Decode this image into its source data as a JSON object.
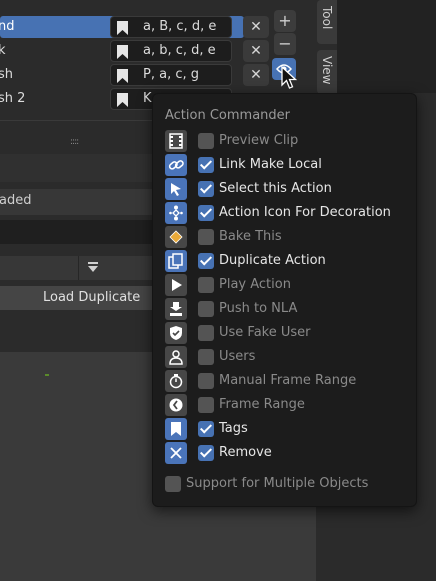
{
  "list": {
    "rows": [
      {
        "name": "nd",
        "tags": "a, B, c, d, e"
      },
      {
        "name": "k",
        "tags": "a, b, c, d, e"
      },
      {
        "name": "sh",
        "tags": "P, a, c, g"
      },
      {
        "name": "sh 2",
        "tags": "K"
      }
    ],
    "remove_glyph": "✕",
    "add_glyph": "+",
    "minus_glyph": "−"
  },
  "tabs": {
    "tool": "Tool",
    "view": "View"
  },
  "panel": {
    "drag_handle": "::::",
    "loaded_label": "aded",
    "load_duplicate": "Load Duplicate"
  },
  "popup": {
    "title": "Action Commander",
    "items": [
      {
        "icon": "film-clip-icon",
        "label": "Preview Clip",
        "checked": false
      },
      {
        "icon": "link-icon",
        "label": "Link Make Local",
        "checked": true
      },
      {
        "icon": "cursor-icon",
        "label": "Select this Action",
        "checked": true
      },
      {
        "icon": "decoration-icon",
        "label": "Action Icon For Decoration",
        "checked": true
      },
      {
        "icon": "keyframe-icon",
        "label": "Bake This",
        "checked": false
      },
      {
        "icon": "duplicate-icon",
        "label": "Duplicate Action",
        "checked": true
      },
      {
        "icon": "play-icon",
        "label": "Play Action",
        "checked": false
      },
      {
        "icon": "push-nla-icon",
        "label": "Push to NLA",
        "checked": false
      },
      {
        "icon": "shield-icon",
        "label": "Use Fake User",
        "checked": false
      },
      {
        "icon": "user-icon",
        "label": "Users",
        "checked": false
      },
      {
        "icon": "stopwatch-icon",
        "label": "Manual Frame Range",
        "checked": false
      },
      {
        "icon": "clock-icon",
        "label": "Frame Range",
        "checked": false
      },
      {
        "icon": "bookmark-icon",
        "label": "Tags",
        "checked": true
      },
      {
        "icon": "close-icon",
        "label": "Remove",
        "checked": true
      }
    ],
    "footer_label": "Support for Multiple Objects",
    "footer_checked": false
  },
  "colors": {
    "accent": "#4772b3",
    "popup_bg": "#1c1c1c",
    "bg": "#2b2b2b"
  }
}
